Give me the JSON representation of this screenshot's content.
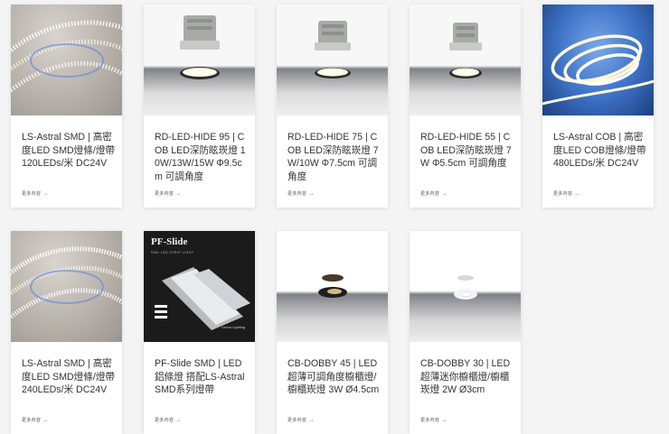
{
  "products": [
    {
      "title": "LS-Astral SMD | 高密度LED SMD燈條/燈帶 120LEDs/米 DC24V",
      "more": "更多內容",
      "image_kind": "led-strip"
    },
    {
      "title": "RD-LED-HIDE 95 | COB LED深防眩崁燈 10W/13W/15W Φ9.5cm 可調角度",
      "more": "更多內容",
      "image_kind": "downlight"
    },
    {
      "title": "RD-LED-HIDE 75 | COB LED深防眩崁燈 7W/10W Φ7.5cm 可調角度",
      "more": "更多內容",
      "image_kind": "downlight"
    },
    {
      "title": "RD-LED-HIDE 55 | COB LED深防眩崁燈 7W Φ5.5cm 可調角度",
      "more": "更多內容",
      "image_kind": "downlight"
    },
    {
      "title": "LS-Astral COB | 高密度LED COB燈條/燈帶 480LEDs/米 DC24V",
      "more": "更多內容",
      "image_kind": "cob-strip"
    },
    {
      "title": "LS-Astral SMD | 高密度LED SMD燈條/燈帶 240LEDs/米 DC24V",
      "more": "更多內容",
      "image_kind": "led-strip"
    },
    {
      "title": "PF-Slide SMD | LED鋁條燈 搭配LS-Astral SMD系列燈帶",
      "more": "更多內容",
      "image_kind": "aluminum-profile",
      "image_text": {
        "brand": "PF-Slide",
        "sub": "SMD LED STRIP LIGHT",
        "caption": "Linear Lighting"
      }
    },
    {
      "title": "CB-DOBBY 45 | LED 超薄可調角度櫥櫃燈/櫥櫃崁燈 3W Ø4.5cm",
      "more": "更多內容",
      "image_kind": "cabinet-light-black"
    },
    {
      "title": "CB-DOBBY 30 | LED 超薄迷你櫥櫃燈/櫥櫃崁燈 2W Ø3cm",
      "more": "更多內容",
      "image_kind": "cabinet-light-white"
    }
  ],
  "arrow_icon": "arrow-right-icon"
}
